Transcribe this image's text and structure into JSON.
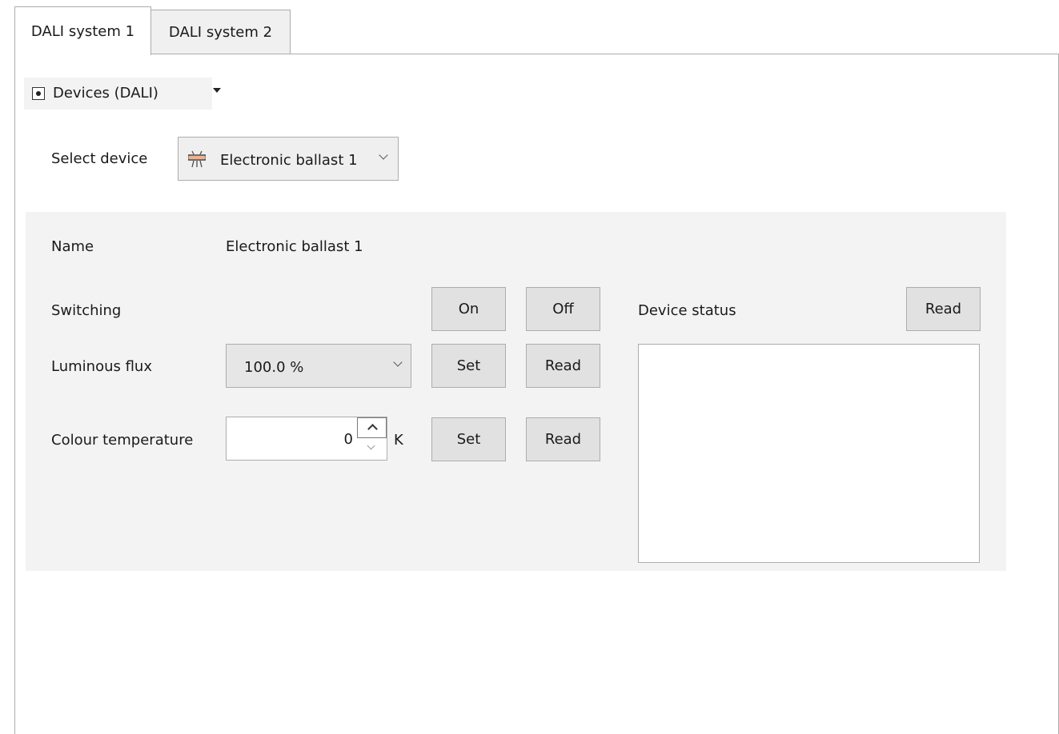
{
  "tabs": [
    {
      "label": "DALI system 1",
      "active": true
    },
    {
      "label": "DALI system 2",
      "active": false
    }
  ],
  "view_selector": {
    "label": "Devices (DALI)",
    "icon": "radio-selected-icon"
  },
  "device_selection": {
    "label": "Select device",
    "selected": "Electronic ballast 1",
    "icon": "ballast-lamp-icon"
  },
  "device": {
    "name_label": "Name",
    "name_value": "Electronic ballast 1",
    "switching": {
      "label": "Switching",
      "on_label": "On",
      "off_label": "Off"
    },
    "luminous_flux": {
      "label": "Luminous flux",
      "value": "100.0 %",
      "set_label": "Set",
      "read_label": "Read"
    },
    "colour_temperature": {
      "label": "Colour temperature",
      "value": "0",
      "unit": "K",
      "set_label": "Set",
      "read_label": "Read"
    },
    "status": {
      "label": "Device status",
      "read_label": "Read",
      "content": ""
    }
  },
  "colors": {
    "panel_bg": "#f3f3f3",
    "button_bg": "#e1e1e1",
    "border": "#adadad"
  }
}
